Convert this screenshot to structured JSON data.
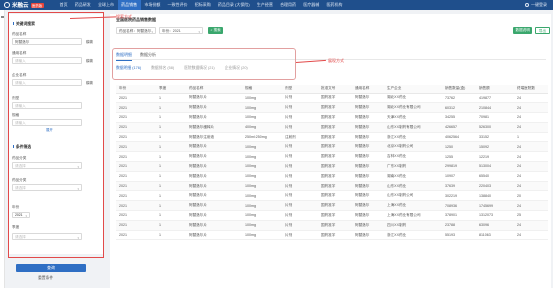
{
  "header": {
    "logo_text": "米融云",
    "logo_badge": "医药版",
    "nav": [
      "首页",
      "药品研发",
      "全球上市",
      "药品销售",
      "市场份额",
      "一致性评价",
      "招标采购",
      "药品目录 (大保险)",
      "生产经营",
      "合理用药",
      "医疗器械",
      "医药机构"
    ],
    "active_nav_index": 3,
    "user_text": "一键登录"
  },
  "filter_panel": {
    "basic_title": "关键词搜索",
    "fields": [
      {
        "label": "药品名称",
        "value": "阿替洛尔",
        "link": "模糊"
      },
      {
        "label": "通用名称",
        "value": "",
        "placeholder": "请输入",
        "link": "模糊"
      },
      {
        "label": "企业名称",
        "value": "",
        "placeholder": "请输入",
        "link": "模糊"
      },
      {
        "label": "剂型",
        "value": "",
        "placeholder": "请输入"
      },
      {
        "label": "规格",
        "value": "",
        "placeholder": "请输入"
      }
    ],
    "expand_label": "展开",
    "attr_title": "条件筛选",
    "selects": [
      {
        "label": "药品分类",
        "placeholder": "请选择"
      },
      {
        "label": "药品分类",
        "placeholder": "请选择"
      }
    ],
    "year_label": "年份",
    "year_value": "2021",
    "quarter_label": "季度",
    "quarter_placeholder": "请选择",
    "query_label": "查询",
    "reset_label": "重置条件"
  },
  "main": {
    "title": "全国医院药品销售数据",
    "filter_drug": "药品名称：阿替洛尔",
    "filter_year": "年份：2021",
    "search_btn": "搜索",
    "add_btn": "数据说明",
    "export_btn": "导出",
    "tabs": [
      "数据明细",
      "数据分析"
    ],
    "active_tab_index": 0,
    "subtabs": [
      "数据明细 (176)",
      "数据排名 (58)",
      "医院数据情况 (21)",
      "企业情况 (20)"
    ],
    "active_subtab_index": 0
  },
  "annotations": {
    "search_method": "搜索方式",
    "view_method": "展现方式"
  },
  "table": {
    "columns": [
      "年份",
      "季度",
      "药品名称",
      "规格",
      "剂型",
      "批准文号",
      "通用名称",
      "生产企业",
      "销售数量(盒)",
      "销售额",
      "终端医院数"
    ],
    "rows": [
      [
        "2021",
        "1",
        "阿替洛尔片",
        "100mg",
        "片剂",
        "国药准字",
        "阿替洛尔",
        "湖北XX药业",
        "73762",
        "419877",
        "24"
      ],
      [
        "2021",
        "1",
        "阿替洛尔片",
        "100mg",
        "片剂",
        "国药准字",
        "阿替洛尔",
        "湖北XX药业有限公司",
        "60312",
        "210844",
        "24"
      ],
      [
        "2021",
        "1",
        "阿替洛尔片",
        "100mg",
        "片剂",
        "国药准字",
        "阿替洛尔",
        "天津XX药业",
        "34255",
        "70981",
        "24"
      ],
      [
        "2021",
        "1",
        "阿替洛尔缓释片",
        "400mg",
        "片剂",
        "国药准字",
        "阿替洛尔",
        "山东XX制药有限公司",
        "426657",
        "526300",
        "24"
      ],
      [
        "2021",
        "1",
        "阿替洛尔注射液",
        "250ml:250mg",
        "注射剂",
        "国药准字",
        "阿替洛尔",
        "浙江XX药业",
        "4062564",
        "33152",
        "1"
      ],
      [
        "2021",
        "1",
        "阿替洛尔片",
        "100mg",
        "片剂",
        "国药准字",
        "阿替洛尔",
        "北京XX制药公司",
        "1250",
        "15092",
        "24"
      ],
      [
        "2021",
        "1",
        "阿替洛尔片",
        "100mg",
        "片剂",
        "国药准字",
        "阿替洛尔",
        "吉林XX药业",
        "1255",
        "12219",
        "24"
      ],
      [
        "2021",
        "1",
        "阿替洛尔片",
        "100mg",
        "片剂",
        "国药准字",
        "阿替洛尔",
        "广东XX制药",
        "299819",
        "513004",
        "24"
      ],
      [
        "2021",
        "1",
        "阿替洛尔片",
        "100mg",
        "片剂",
        "国药准字",
        "阿替洛尔",
        "湖南XX药业",
        "10907",
        "65540",
        "24"
      ],
      [
        "2021",
        "1",
        "阿替洛尔片",
        "100mg",
        "片剂",
        "国药准字",
        "阿替洛尔",
        "山东XX药业",
        "37639",
        "220403",
        "24"
      ],
      [
        "2021",
        "1",
        "阿替洛尔片",
        "100mg",
        "片剂",
        "国药准字",
        "阿替洛尔",
        "山东XX制药公司",
        "302219",
        "138840",
        "20"
      ],
      [
        "2021",
        "1",
        "阿替洛尔片",
        "100mg",
        "片剂",
        "国药准字",
        "阿替洛尔",
        "上海XX药业",
        "708936",
        "1745699",
        "24"
      ],
      [
        "2021",
        "1",
        "阿替洛尔片",
        "100mg",
        "片剂",
        "国药准字",
        "阿替洛尔",
        "上海XX药业有限公司",
        "378901",
        "1312073",
        "25"
      ],
      [
        "2021",
        "1",
        "阿替洛尔片",
        "100mg",
        "片剂",
        "国药准字",
        "阿替洛尔",
        "四川XX制药",
        "23788",
        "63096",
        "24"
      ],
      [
        "2021",
        "1",
        "阿替洛尔片",
        "100mg",
        "片剂",
        "国药准字",
        "阿替洛尔",
        "浙江XX药业",
        "55193",
        "811063",
        "24"
      ]
    ]
  }
}
